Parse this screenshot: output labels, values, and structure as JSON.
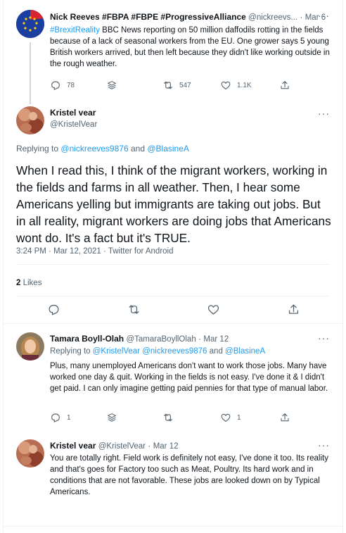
{
  "tweet1": {
    "name": "Nick Reeves #FBPA #FBPE #ProgressiveAlliance",
    "handle": "@nickreevs...",
    "dot": "·",
    "date": "Mar 6",
    "hashtag": "#BrexitReality",
    "text": " BBC News reporting on 50 million daffodils rotting in the fields because of a lack of seasonal workers from the EU. One grower says 5 young British workers arrived, but then left because they didn't like working outside in the rough weather.",
    "replies": "78",
    "retweets": "547",
    "likes": "1.1K"
  },
  "main": {
    "name": "Kristel vear",
    "handle": "@KristelVear",
    "replying_to": "Replying to",
    "reply_handle_1": "@nickreeves9876",
    "and": "and",
    "reply_handle_2": "@BlasineA",
    "text": "When I read this, I think of the migrant workers, working in the fields and farms in all weather. Then, I hear some Americans yelling but immigrants are taking out jobs. But in all reality, migrant workers are doing jobs that Americans wont do. It's a fact but it's TRUE.",
    "timestamp": "3:24 PM · Mar 12, 2021 · Twitter for Android",
    "likes_count": "2",
    "likes_label": "Likes"
  },
  "reply1": {
    "name": "Tamara Boyll-Olah",
    "handle": "@TamaraBoyllOlah",
    "dot": "·",
    "date": "Mar 12",
    "replying_to": "Replying to",
    "handles": "@KristelVear @nickreeves9876",
    "and": "and",
    "handle_last": "@BlasineA",
    "text": "Plus, many unemployed Americans don't want to work those jobs. Many have worked one day & quit. Working in the fields is not easy. I've done it & I didn't get paid. I can only imagine getting paid pennies for that type of manual labor.",
    "replies": "1",
    "likes": "1"
  },
  "reply2": {
    "name": "Kristel vear",
    "handle": "@KristelVear",
    "dot": "·",
    "date": "Mar 12",
    "text": "You are totally right. Field work is definitely not easy, I've done it too. Its reality and that's goes for Factory too such as Meat, Poultry. Its hard work and in conditions that are not favorable. These jobs are looked down on by Typical Americans."
  },
  "more_glyph": "···",
  "colors": {
    "link": "#1d9bf0",
    "muted": "#536471",
    "text": "#0f1419",
    "divider": "#eff3f4"
  },
  "icons": [
    "reply-icon",
    "stack-icon",
    "retweet-icon",
    "like-icon",
    "share-icon"
  ]
}
